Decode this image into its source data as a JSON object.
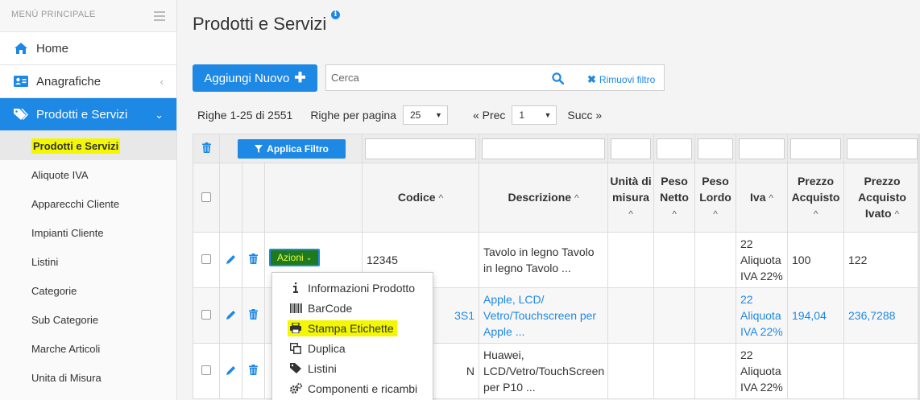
{
  "sidebar": {
    "header": "MENÙ PRINCIPALE",
    "home": "Home",
    "anagrafiche": "Anagrafiche",
    "prodotti": "Prodotti e Servizi",
    "subitems": [
      "Prodotti e Servizi",
      "Aliquote IVA",
      "Apparecchi Cliente",
      "Impianti Cliente",
      "Listini",
      "Categorie",
      "Sub Categorie",
      "Marche Articoli",
      "Unita di Misura"
    ]
  },
  "page": {
    "title": "Prodotti e Servizi",
    "info_icon": "i",
    "add_button": "Aggiungi Nuovo",
    "search_placeholder": "Cerca",
    "remove_filter": "Rimuovi filtro"
  },
  "pager": {
    "range": "Righe 1-25 di 2551",
    "per_page_label": "Righe per pagina",
    "per_page_value": "25",
    "prev": "« Prec",
    "page_value": "1",
    "next": "Succ »"
  },
  "table": {
    "apply_filter": "Applica Filtro",
    "headers": {
      "codice": "Codice",
      "descrizione": "Descrizione",
      "unita": "Unità di misura",
      "peso_netto": "Peso Netto",
      "peso_lordo": "Peso Lordo",
      "iva": "Iva",
      "prezzo_acquisto": "Prezzo Acquisto",
      "prezzo_ivato": "Prezzo Acquisto Ivato"
    },
    "azioni_label": "Azioni",
    "rows": [
      {
        "codice": "12345",
        "descrizione": "Tavolo in legno Tavolo in legno Tavolo ...",
        "iva": "22 Aliquota IVA 22%",
        "prezzo": "100",
        "ivato": "122"
      },
      {
        "codice": "3S1",
        "descrizione": "Apple, LCD/ Vetro/Touchscreen per Apple ...",
        "iva": "22 Aliquota IVA 22%",
        "prezzo": "194,04",
        "ivato": "236,7288"
      },
      {
        "codice": "N",
        "descrizione": "Huawei, LCD/Vetro/TouchScreen per P10 ...",
        "iva": "22 Aliquota IVA 22%",
        "prezzo": "",
        "ivato": ""
      }
    ]
  },
  "dropdown": {
    "items": [
      "Informazioni Prodotto",
      "BarCode",
      "Stampa Etichette",
      "Duplica",
      "Listini",
      "Componenti e ricambi"
    ],
    "icons": [
      "info-icon",
      "barcode-icon",
      "print-icon",
      "copy-icon",
      "tag-icon",
      "cogs-icon"
    ]
  },
  "colors": {
    "primary": "#1e88e5",
    "highlight": "#f3f700",
    "azioni_bg": "#1f7a1f"
  }
}
